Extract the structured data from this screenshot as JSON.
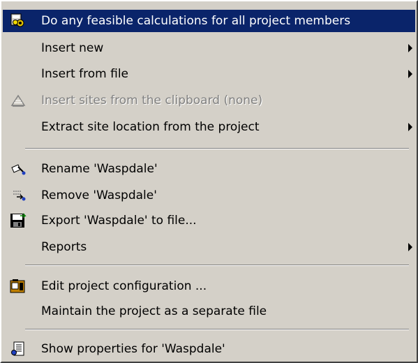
{
  "menu": {
    "items": [
      {
        "label": "Do any feasible calculations for all project members",
        "icon": "calculator-gears-icon",
        "highlighted": true
      },
      {
        "label": "Insert new",
        "submenu": true
      },
      {
        "label": "Insert from file",
        "submenu": true
      },
      {
        "label": "Insert sites from the clipboard (none)",
        "icon": "clipboard-sites-icon",
        "disabled": true
      },
      {
        "label": "Extract site location from the project",
        "submenu": true
      },
      {
        "label": "Rename 'Waspdale'",
        "icon": "rename-pencil-icon"
      },
      {
        "label": "Remove 'Waspdale'",
        "icon": "remove-icon"
      },
      {
        "label": "Export 'Waspdale' to file...",
        "icon": "export-floppy-icon"
      },
      {
        "label": "Reports",
        "submenu": true
      },
      {
        "label": "Edit project configuration ...",
        "icon": "project-config-icon"
      },
      {
        "label": "Maintain the project as a separate file"
      },
      {
        "label": "Show properties for 'Waspdale'",
        "icon": "properties-sheet-icon"
      }
    ]
  },
  "colors": {
    "highlight": "#0a246a",
    "menu_background": "#d4d0c8",
    "disabled_text": "#808080"
  }
}
